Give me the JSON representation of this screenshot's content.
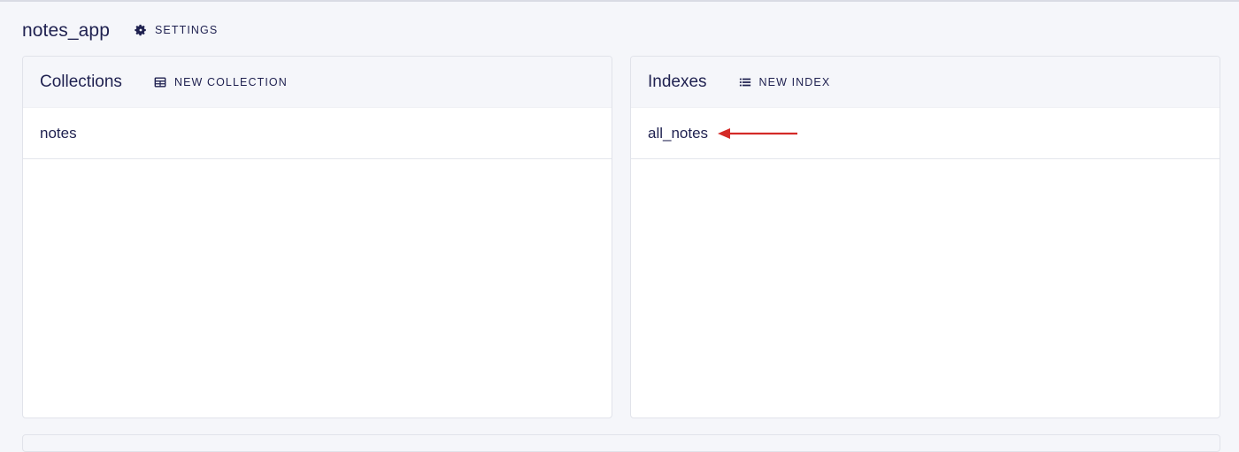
{
  "header": {
    "db_name": "notes_app",
    "settings_label": "SETTINGS"
  },
  "collections": {
    "title": "Collections",
    "new_label": "NEW COLLECTION",
    "items": [
      "notes"
    ]
  },
  "indexes": {
    "title": "Indexes",
    "new_label": "NEW INDEX",
    "items": [
      "all_notes"
    ]
  },
  "icons": {
    "settings": "gear-icon",
    "new_collection": "table-icon",
    "new_index": "list-icon",
    "annotation": "arrow-left-icon"
  },
  "colors": {
    "text": "#1f2150",
    "background": "#f5f6fa",
    "annotation_arrow": "#d42a27"
  }
}
